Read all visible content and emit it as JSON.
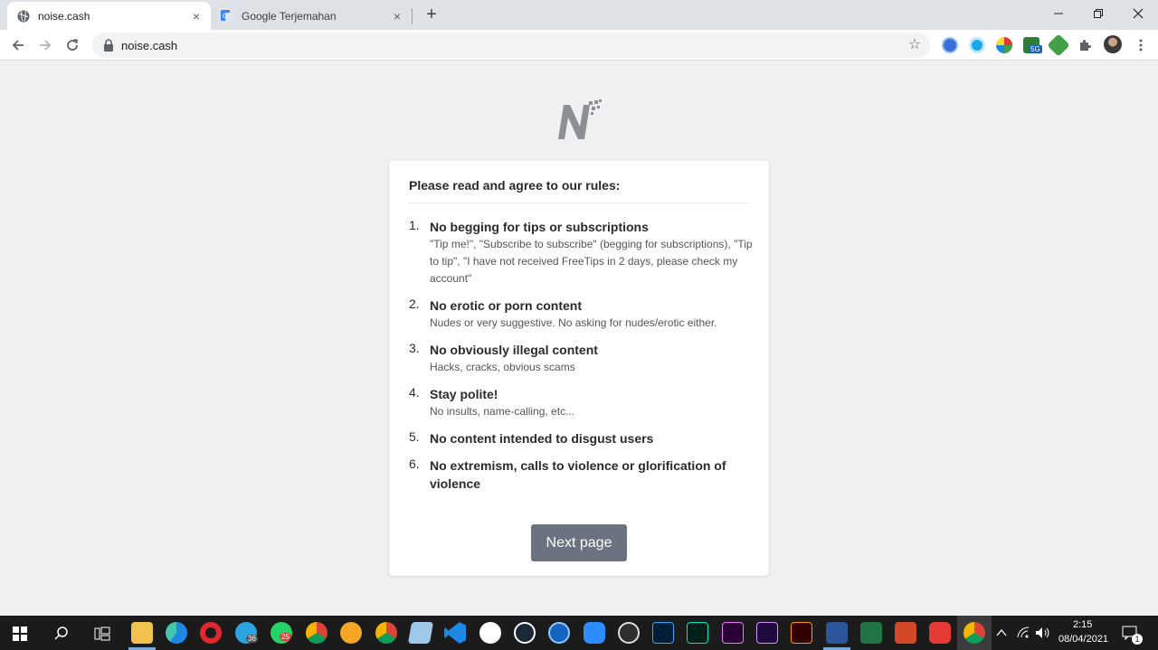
{
  "browser": {
    "tabs": [
      {
        "title": "noise.cash",
        "active": true
      },
      {
        "title": "Google Terjemahan",
        "active": false
      }
    ],
    "new_tab": "+",
    "close_glyph": "×",
    "address": "noise.cash"
  },
  "page": {
    "card_title": "Please read and agree to our rules:",
    "rules": [
      {
        "num": "1.",
        "title": "No begging for tips or subscriptions",
        "desc": "\"Tip me!\", \"Subscribe to subscribe\" (begging for subscriptions), \"Tip to tip\", \"I have not received FreeTips in 2 days, please check my account\""
      },
      {
        "num": "2.",
        "title": "No erotic or porn content",
        "desc": "Nudes or very suggestive. No asking for nudes/erotic either."
      },
      {
        "num": "3.",
        "title": "No obviously illegal content",
        "desc": "Hacks, cracks, obvious scams"
      },
      {
        "num": "4.",
        "title": "Stay polite!",
        "desc": "No insults, name-calling, etc..."
      },
      {
        "num": "5.",
        "title": "No content intended to disgust users",
        "desc": ""
      },
      {
        "num": "6.",
        "title": "No extremism, calls to violence or glorification of violence",
        "desc": ""
      }
    ],
    "next_label": "Next page"
  },
  "taskbar": {
    "time": "2:15",
    "date": "08/04/2021",
    "badge_telegram": "36",
    "badge_whatsapp": "25",
    "notif_count": "1",
    "ext_badge": "5G"
  },
  "colors": {
    "accent_button": "#6b7280",
    "page_bg": "#f0f0f2"
  }
}
